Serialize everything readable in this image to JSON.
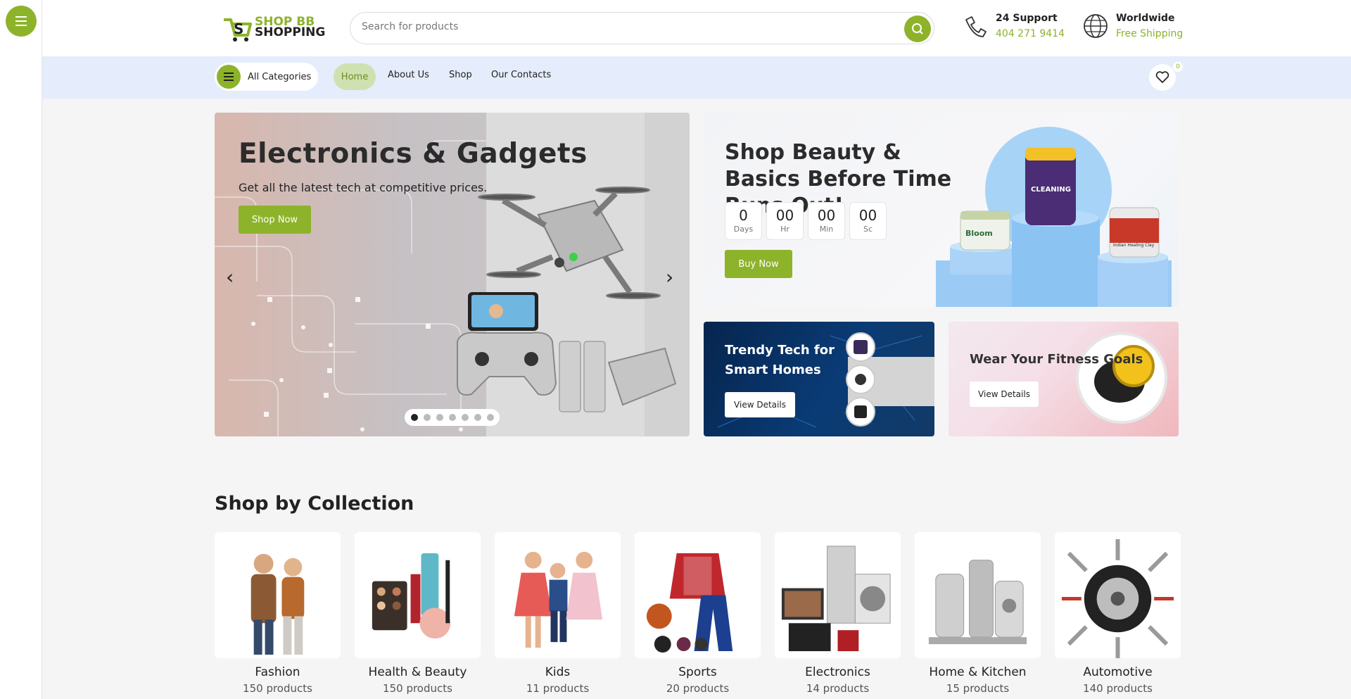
{
  "colors": {
    "accent": "#8db32a",
    "navbar_bg": "#e5ecfb"
  },
  "header": {
    "logo_line1": "SHOP BB",
    "logo_line2": "SHOPPING",
    "search_placeholder": "Search for products",
    "support_title": "24 Support",
    "support_phone": "404 271 9414",
    "shipping_title": "Worldwide",
    "shipping_sub": "Free Shipping"
  },
  "nav": {
    "categories_label": "All Categories",
    "links": [
      "Home",
      "About Us",
      "Shop",
      "Our Contacts"
    ],
    "wishlist_count": "0"
  },
  "hero": {
    "title": "Electronics & Gadgets",
    "subtitle": "Get all the latest tech at competitive prices.",
    "button": "Shop Now",
    "prev": "‹",
    "next": "›",
    "slide_count": 7,
    "active_slide": 1
  },
  "promo": {
    "title": "Shop Beauty & Basics Before Time Runs Out!",
    "countdown": [
      {
        "value": "0",
        "unit": "Days"
      },
      {
        "value": "00",
        "unit": "Hr"
      },
      {
        "value": "00",
        "unit": "Min"
      },
      {
        "value": "00",
        "unit": "Sc"
      }
    ],
    "button": "Buy Now",
    "products": [
      "Bloom",
      "CLEANING",
      "Indian Healing Clay"
    ]
  },
  "tiles": [
    {
      "title": "Trendy Tech for Smart Homes",
      "button": "View Details"
    },
    {
      "title": "Wear Your Fitness Goals",
      "button": "View Details"
    }
  ],
  "collection": {
    "title": "Shop by Collection",
    "items": [
      {
        "name": "Fashion",
        "count": "150 products"
      },
      {
        "name": "Health & Beauty",
        "count": "150 products"
      },
      {
        "name": "Kids",
        "count": "11 products"
      },
      {
        "name": "Sports",
        "count": "20 products"
      },
      {
        "name": "Electronics",
        "count": "14 products"
      },
      {
        "name": "Home & Kitchen",
        "count": "15 products"
      },
      {
        "name": "Automotive",
        "count": "140 products"
      }
    ]
  }
}
